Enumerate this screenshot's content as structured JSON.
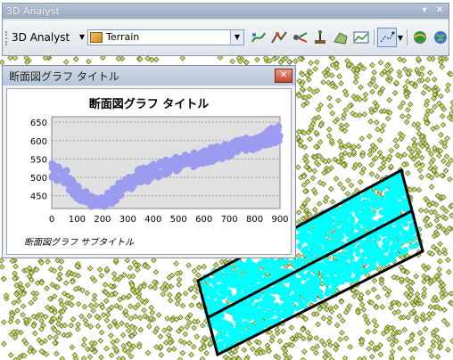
{
  "toolbar": {
    "title": "3D Analyst",
    "controls": {
      "dropdown": "▾",
      "close": "✕"
    },
    "menu_label": "3D Analyst",
    "layer_value": "Terrain",
    "tools": [
      "interpolate-line-icon",
      "steepest-path-icon",
      "line-of-sight-icon",
      "interpolate-point-icon",
      "interpolate-polygon-icon",
      "profile-graph-icon",
      "line-tool-icon",
      "arcscene-icon",
      "arcglobe-icon"
    ]
  },
  "profile_window": {
    "title": "断面図グラフ タイトル",
    "close": "✕"
  },
  "chart_data": {
    "type": "scatter",
    "title": "断面図グラフ タイトル",
    "subtitle": "断面図グラフ サブタイトル",
    "xlabel": "",
    "ylabel": "",
    "xlim": [
      0,
      900
    ],
    "ylim": [
      415,
      665
    ],
    "xticks": [
      0,
      100,
      200,
      300,
      400,
      500,
      600,
      700,
      800,
      900
    ],
    "yticks": [
      450,
      500,
      550,
      600,
      650
    ],
    "grid": true,
    "marker_color": "#9b9bf0",
    "series": [
      {
        "values_x": [
          0,
          20,
          40,
          60,
          80,
          100,
          120,
          140,
          160,
          180,
          200,
          220,
          240,
          260,
          280,
          300,
          320,
          340,
          360,
          380,
          400,
          420,
          440,
          460,
          480,
          500,
          520,
          540,
          560,
          580,
          600,
          620,
          640,
          660,
          680,
          700,
          720,
          740,
          760,
          780,
          800,
          820,
          840,
          860,
          880
        ],
        "values_y": [
          530,
          523,
          510,
          497,
          480,
          468,
          458,
          446,
          438,
          436,
          440,
          448,
          463,
          478,
          488,
          500,
          510,
          514,
          518,
          522,
          528,
          533,
          538,
          540,
          545,
          550,
          553,
          558,
          562,
          565,
          568,
          572,
          575,
          580,
          585,
          590,
          592,
          595,
          598,
          602,
          605,
          610,
          618,
          625,
          635
        ]
      },
      {
        "values_x": [
          0,
          20,
          40,
          60,
          80,
          100,
          120,
          140,
          160,
          180,
          200,
          220,
          240,
          260,
          280,
          300,
          320,
          340,
          360,
          380,
          400,
          420,
          440,
          460,
          480,
          500,
          520,
          540,
          560,
          580,
          600,
          620,
          640,
          660,
          680,
          700,
          720,
          740,
          760,
          780,
          800,
          820,
          840,
          860,
          880
        ],
        "values_y": [
          505,
          498,
          485,
          470,
          456,
          444,
          436,
          428,
          425,
          424,
          428,
          436,
          446,
          458,
          468,
          478,
          486,
          492,
          498,
          502,
          508,
          512,
          516,
          520,
          524,
          530,
          534,
          538,
          541,
          545,
          548,
          552,
          556,
          560,
          564,
          568,
          572,
          576,
          580,
          582,
          586,
          590,
          595,
          600,
          608
        ]
      }
    ]
  },
  "map": {
    "point_color": "#c8dc6a",
    "selection_color": "#00ffff",
    "profile_line_color": "#000000"
  }
}
